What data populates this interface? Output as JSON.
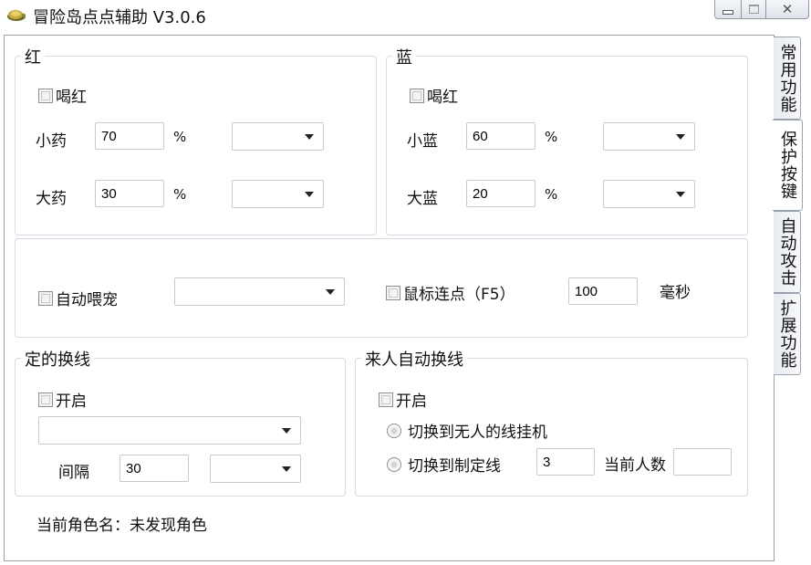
{
  "window": {
    "title": "冒险岛点点辅助 V3.0.6",
    "close_glyph": "✕"
  },
  "tabs": [
    "常用功能",
    "保护按键",
    "自动攻击",
    "扩展功能"
  ],
  "red": {
    "title": "红",
    "drink": "喝红",
    "small_label": "小药",
    "small_value": "70",
    "small_unit": "%",
    "large_label": "大药",
    "large_value": "30",
    "large_unit": "%"
  },
  "blue": {
    "title": "蓝",
    "drink": "喝红",
    "small_label": "小蓝",
    "small_value": "60",
    "small_unit": "%",
    "large_label": "大蓝",
    "large_value": "20",
    "large_unit": "%"
  },
  "pet": {
    "feed_label": "自动喂宠",
    "mouse_label": "鼠标连点（F5）",
    "mouse_value": "100",
    "mouse_unit": "毫秒"
  },
  "timed_switch": {
    "title": "定的换线",
    "enable": "开启",
    "interval_label": "间隔",
    "interval_value": "30"
  },
  "auto_switch": {
    "title": "来人自动换线",
    "enable": "开启",
    "option1": "切换到无人的线挂机",
    "option2": "切换到制定线",
    "line_value": "3",
    "count_label": "当前人数",
    "count_value": ""
  },
  "status": {
    "character": "当前角色名：未发现角色"
  }
}
